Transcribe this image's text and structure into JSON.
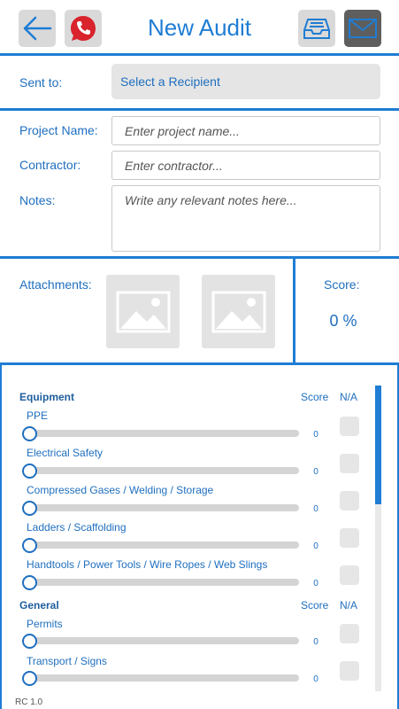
{
  "header": {
    "title": "New Audit",
    "back_icon": "back-arrow-icon",
    "phone_icon": "phone-icon",
    "inbox_icon": "inbox-icon",
    "mail_icon": "mail-icon"
  },
  "recipient": {
    "label": "Sent to:",
    "select_value": "Select a Recipient"
  },
  "form": {
    "project_label": "Project Name:",
    "project_placeholder": "Enter project name...",
    "contractor_label": "Contractor:",
    "contractor_placeholder": "Enter contractor...",
    "notes_label": "Notes:",
    "notes_placeholder": "Write any relevant notes here..."
  },
  "attachments": {
    "label": "Attachments:",
    "icon": "image-placeholder-icon"
  },
  "score": {
    "label": "Score:",
    "value": "0 %"
  },
  "sections": [
    {
      "title": "Equipment",
      "score_header": "Score",
      "na_header": "N/A",
      "items": [
        {
          "label": "PPE",
          "value": "0"
        },
        {
          "label": "Electrical Safety",
          "value": "0"
        },
        {
          "label": "Compressed Gases / Welding / Storage",
          "value": "0"
        },
        {
          "label": "Ladders / Scaffolding",
          "value": "0"
        },
        {
          "label": "Handtools / Power Tools / Wire Ropes / Web Slings",
          "value": "0"
        }
      ]
    },
    {
      "title": "General",
      "score_header": "Score",
      "na_header": "N/A",
      "items": [
        {
          "label": "Permits",
          "value": "0"
        },
        {
          "label": "Transport / Signs",
          "value": "0"
        }
      ]
    }
  ],
  "footer": {
    "version": "RC 1.0"
  },
  "colors": {
    "accent": "#1f7dd4",
    "text": "#1f6fbf",
    "phone_red": "#d9232d"
  }
}
